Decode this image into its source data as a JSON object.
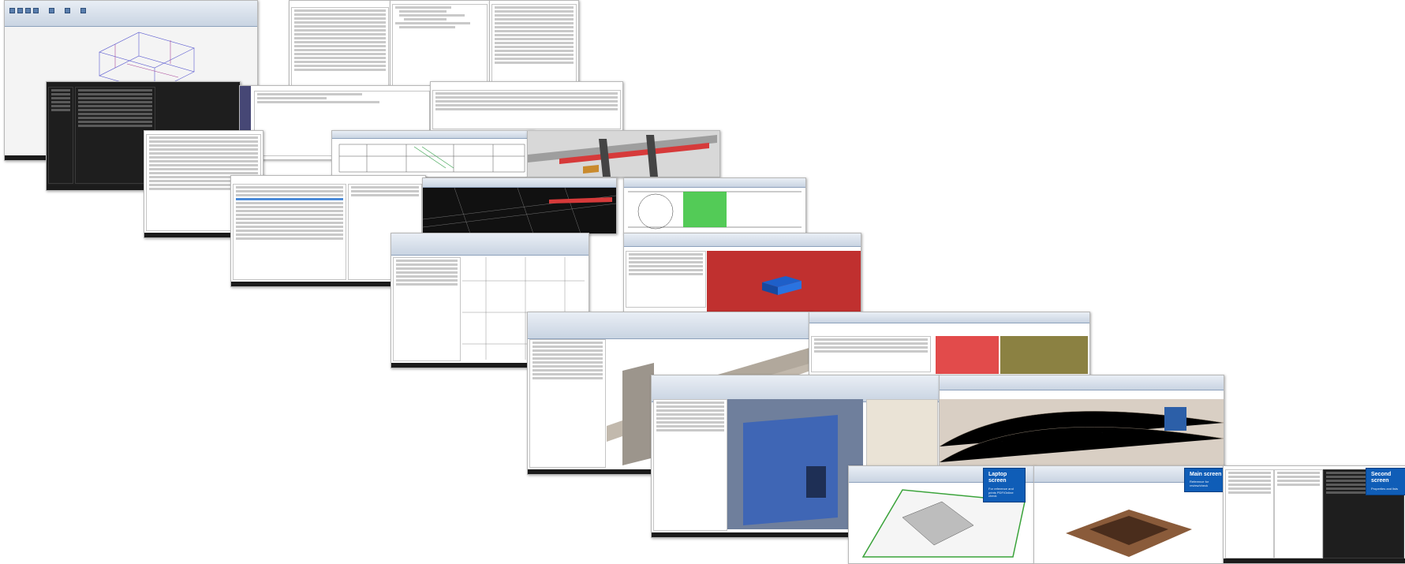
{
  "colors": {
    "ribbon": "#c9d4e2",
    "taskbar": "#1b1b1b",
    "revit_blue": "#5a7fae",
    "highlight_red": "#d63a3a",
    "highlight_green": "#35c23a",
    "badge_blue": "#0f5db7"
  },
  "screens": {
    "laptop": {
      "title": "Laptop screen",
      "desc": "For reference and prints PDF/Online check"
    },
    "main": {
      "title": "Main screen",
      "desc": "Reference for review/check"
    },
    "second": {
      "title": "Second screen",
      "desc": "Properties and lists"
    }
  }
}
